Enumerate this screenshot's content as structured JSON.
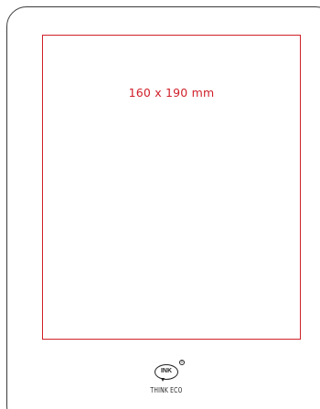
{
  "print_area": {
    "dimension_label": "160 x 190 mm"
  },
  "brand": {
    "logo_mark": "INK",
    "logo_text": "THINK ECO",
    "registered_symbol": "®"
  },
  "colors": {
    "print_area_border": "#d0202a",
    "dimension_text": "#d0202a",
    "outline": "#3a3a3a"
  }
}
